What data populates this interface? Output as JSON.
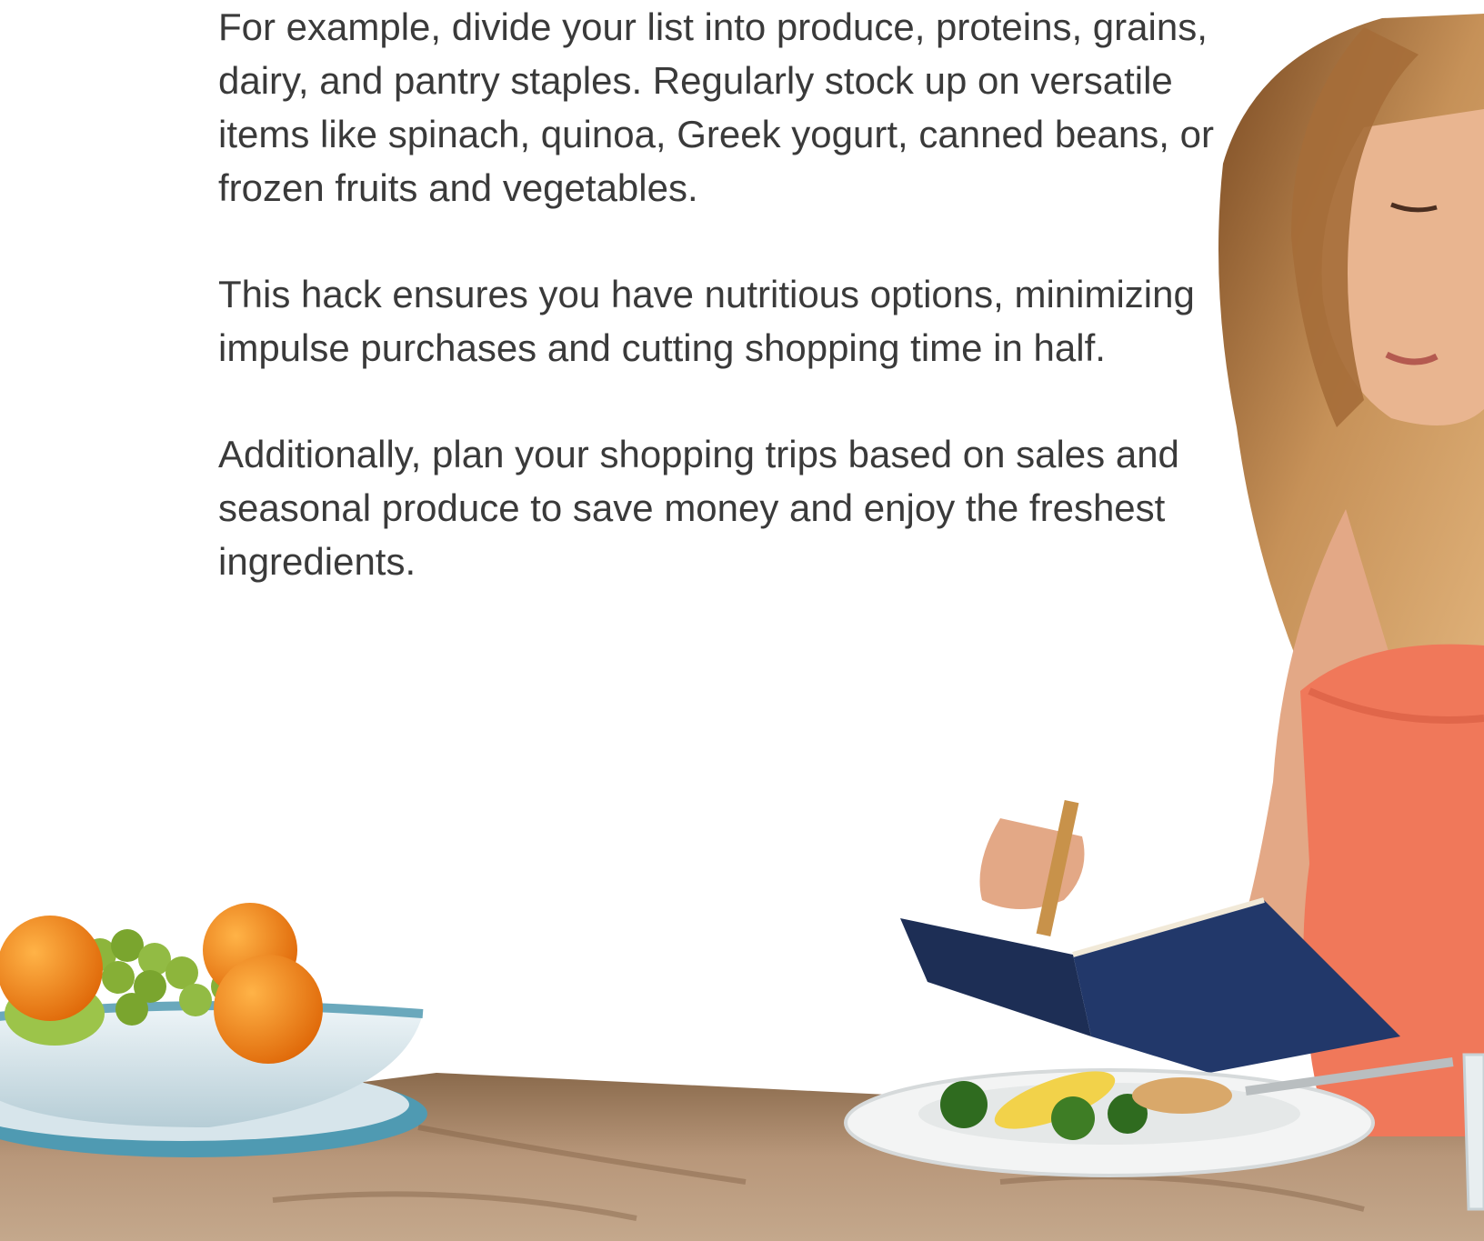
{
  "article": {
    "paragraphs": [
      "For example, divide your list into produce, proteins, grains, dairy, and pantry staples. Regularly stock up on versatile items like spinach, quinoa, Greek yogurt, canned beans, or frozen fruits and vegetables.",
      "This hack ensures you have nutritious options, minimizing impulse purchases and cutting shopping time in half.",
      "Additionally, plan your shopping trips based on sales and seasonal produce to save money and enjoy the freshest ingredients."
    ]
  },
  "colors": {
    "text": "#3a3a3a",
    "background": "#ffffff",
    "shirt": "#f07a5c",
    "hair": "#b07a45",
    "skin": "#e8b08c",
    "notebook": "#1d2e55",
    "countertop": "#a88563",
    "bowl": "#d8e6ec",
    "orange": "#f08a1e",
    "grape": "#8ab33a"
  }
}
